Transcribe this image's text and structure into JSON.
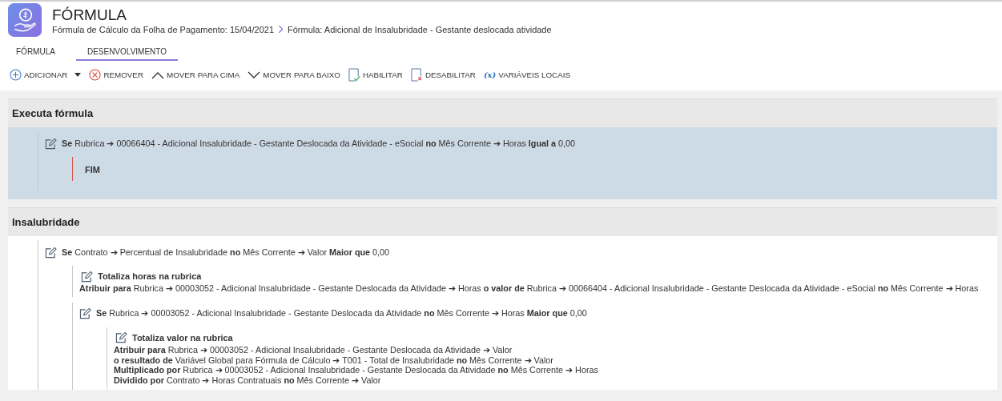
{
  "header": {
    "title": "FÓRMULA",
    "breadcrumb": [
      "Fórmula de Cálculo da Folha de Pagamento: 15/04/2021",
      "Fórmula: Adicional de Insalubridade - Gestante deslocada atividade"
    ]
  },
  "tabs": [
    {
      "label": "FÓRMULA",
      "selected": false
    },
    {
      "label": "DESENVOLVIMENTO",
      "selected": true
    }
  ],
  "toolbar": [
    {
      "kind": "add",
      "label": "ADICIONAR",
      "dropdown": true
    },
    {
      "kind": "remove",
      "label": "REMOVER"
    },
    {
      "kind": "up",
      "label": "MOVER PARA CIMA"
    },
    {
      "kind": "down",
      "label": "MOVER PARA BAIXO"
    },
    {
      "kind": "enable",
      "label": "HABILITAR"
    },
    {
      "kind": "disable",
      "label": "DESABILITAR"
    },
    {
      "kind": "variables",
      "glyph": "(x)",
      "label": "VARIÁVEIS LOCAIS"
    }
  ],
  "sections": [
    {
      "title": "Executa fórmula",
      "selected": true,
      "nodes": [
        {
          "kind": "if",
          "text": "**Se** Rubrica ➔ 00066404 - Adicional Insalubridade - Gestante Deslocada da Atividade - eSocial **no** Mês Corrente ➔ Horas **Igual a** 0,00",
          "children": [
            {
              "kind": "end",
              "text": "FIM"
            }
          ]
        }
      ]
    },
    {
      "title": "Insalubridade",
      "selected": false,
      "nodes": [
        {
          "kind": "if",
          "text": "**Se** Contrato ➔ Percentual de Insalubridade **no** Mês Corrente ➔ Valor **Maior que** 0,00",
          "children": [
            {
              "kind": "action",
              "title": "Totaliza horas na rubrica",
              "lines": [
                "**Atribuir para** Rubrica ➔ 00003052 - Adicional Insalubridade - Gestante Deslocada da Atividade ➔ Horas **o valor de** Rubrica ➔ 00066404 - Adicional Insalubridade - Gestante Deslocada da Atividade - eSocial **no** Mês Corrente ➔ Horas"
              ]
            },
            {
              "kind": "if",
              "text": "**Se** Rubrica ➔ 00003052 - Adicional Insalubridade - Gestante Deslocada da Atividade **no** Mês Corrente ➔ Horas **Maior que** 0,00",
              "children": [
                {
                  "kind": "action",
                  "title": "Totaliza valor na rubrica",
                  "lines": [
                    "**Atribuir para** Rubrica ➔ 00003052 - Adicional Insalubridade - Gestante Deslocada da Atividade ➔ Valor",
                    "**o resultado de** Variável Global para Fórmula de Cálculo ➔ T001 - Total de Insalubridade **no** Mês Corrente ➔ Valor",
                    "**Multiplicado por** Rubrica ➔ 00003052 - Adicional Insalubridade - Gestante Deslocada da Atividade **no** Mês Corrente ➔ Horas",
                    "**Dividido por** Contrato ➔ Horas Contratuais **no** Mês Corrente ➔ Valor"
                  ]
                }
              ]
            }
          ]
        }
      ]
    }
  ]
}
